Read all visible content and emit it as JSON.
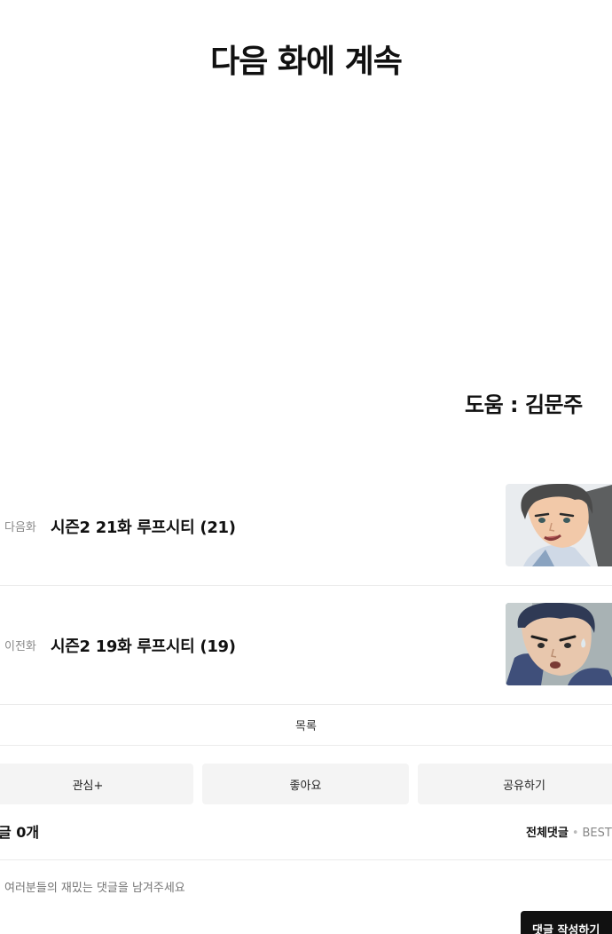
{
  "panel": {
    "title_text": "다음 화에 계속",
    "credit_text": "도움 : 김문주"
  },
  "next_episode": {
    "tag": "다음화",
    "title": "시즌2 21화 루프시티 (21)",
    "thumb_icon": "character-thumbnail-smiling-man"
  },
  "prev_episode": {
    "tag": "이전화",
    "title": "시즌2 19화 루프시티 (19)",
    "thumb_icon": "character-thumbnail-worried-man"
  },
  "list_label": "목록",
  "actions": {
    "subscribe_label": "관심+",
    "like_label": "좋아요",
    "share_label": "공유하기"
  },
  "comments": {
    "count_label": "글 0개",
    "filter_all": "전체댓글",
    "filter_best": "BEST댓",
    "input_placeholder": "여러분들의 재밌는 댓글을 남겨주세요",
    "submit_label": "댓글 작성하기"
  },
  "colors": {
    "button_bg": "#f4f4f4",
    "divider": "#ebebeb",
    "submit_bg": "#111111"
  }
}
